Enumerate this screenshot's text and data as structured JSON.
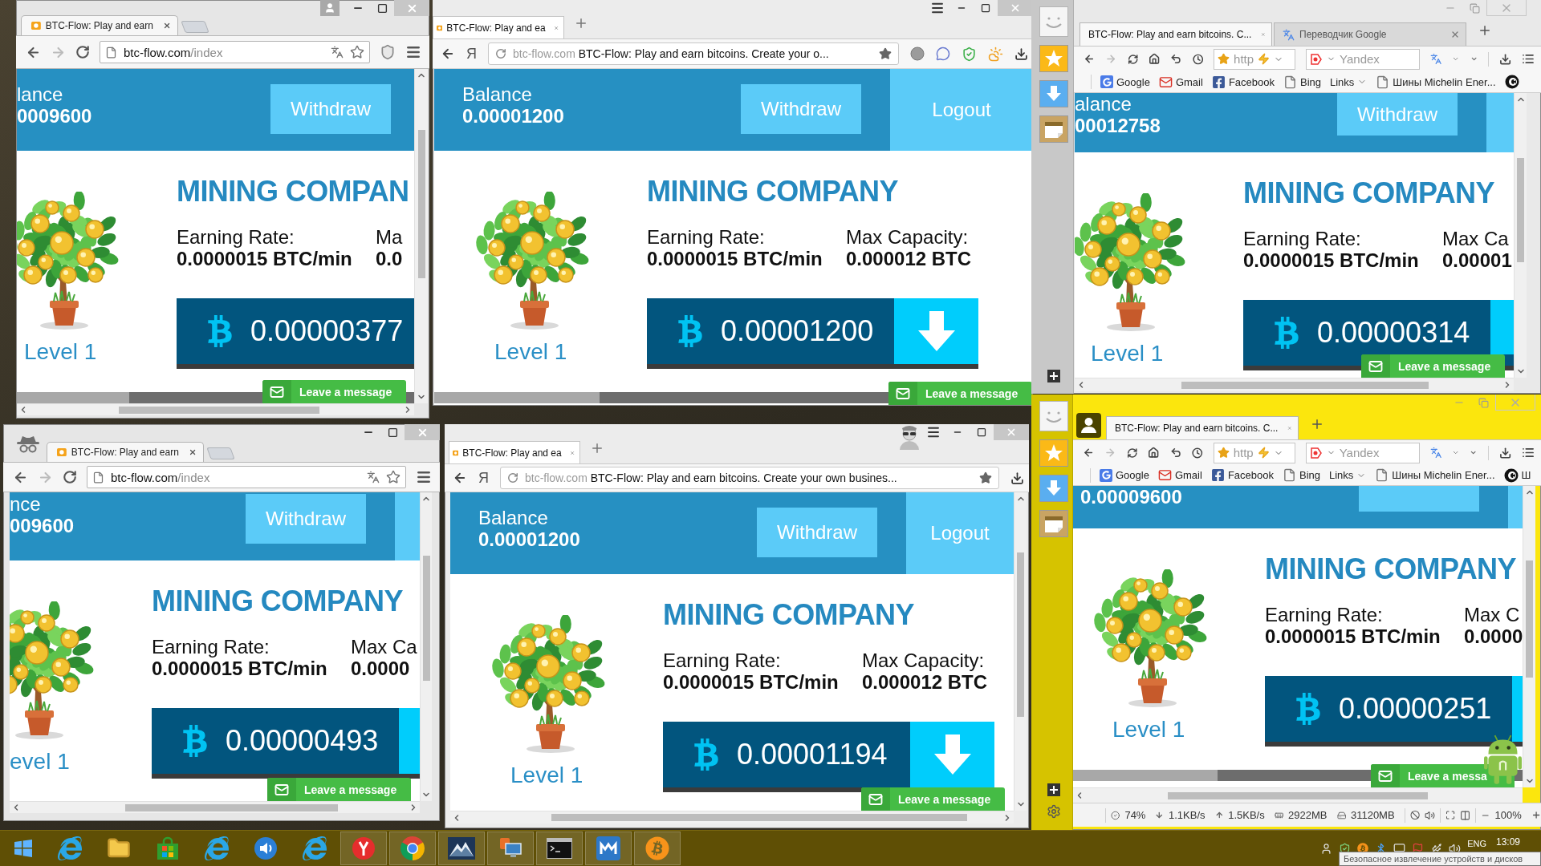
{
  "windows": [
    {
      "kind": "chrome",
      "incognito": false,
      "tabs": [
        {
          "title": "BTC-Flow: Play and earn",
          "selected": true
        }
      ],
      "address": {
        "host": "btc-flow.com",
        "path": "/index"
      },
      "page": {
        "balance_label": "lance",
        "balance": "0009600",
        "withdraw": "Withdraw",
        "heading": "MINING COMPAN",
        "stats": [
          {
            "label": "Earning Rate:",
            "value": "0.0000015 BTC/min"
          },
          {
            "label": "Ma",
            "value": "0.0"
          }
        ],
        "counter": "0.00000377",
        "level": "Level 1",
        "chat": "Leave a message"
      }
    },
    {
      "kind": "yandex",
      "incognito": false,
      "tabs": [
        {
          "title": "BTC-Flow: Play and ea",
          "selected": true
        }
      ],
      "home_button": "Я",
      "address": {
        "host": "btc-flow.com",
        "title": "BTC-Flow: Play and earn bitcoins. Create your o..."
      },
      "page": {
        "balance_label": "Balance",
        "balance": "0.00001200",
        "withdraw": "Withdraw",
        "logout": "Logout",
        "heading": "MINING COMPANY",
        "stats": [
          {
            "label": "Earning Rate:",
            "value": "0.0000015 BTC/min"
          },
          {
            "label": "Max Capacity:",
            "value": "0.000012 BTC"
          }
        ],
        "counter": "0.00001200",
        "level": "Level 1",
        "chat": "Leave a message"
      }
    },
    {
      "kind": "maxthon",
      "incognito": false,
      "tabs": [
        {
          "kind": "plain",
          "title": "BTC-Flow: Play and earn bitcoins. C...",
          "selected": true
        },
        {
          "kind": "translator",
          "title": "Переводчик Google",
          "selected": false
        }
      ],
      "address": "http",
      "search": {
        "placeholder": "Yandex"
      },
      "bookmarks": [
        {
          "kind": "google",
          "label": "Google"
        },
        {
          "kind": "gmail",
          "label": "Gmail"
        },
        {
          "kind": "facebook",
          "label": "Facebook"
        },
        {
          "kind": "page",
          "label": "Bing"
        },
        {
          "kind": "folder",
          "label": "Links"
        },
        {
          "kind": "page",
          "label": "Шины Michelin Ener..."
        },
        {
          "kind": "app"
        }
      ],
      "page": {
        "balance_label": "alance",
        "balance": "00012758",
        "withdraw": "Withdraw",
        "heading": "MINING COMPANY",
        "stats": [
          {
            "label": "Earning Rate:",
            "value": "0.0000015 BTC/min"
          },
          {
            "label": "Max Ca",
            "value": "0.00001"
          }
        ],
        "counter": "0.00000314",
        "level": "Level 1",
        "chat": "Leave a message"
      }
    },
    {
      "kind": "chrome",
      "incognito": true,
      "tabs": [
        {
          "title": "BTC-Flow: Play and earn",
          "selected": true
        }
      ],
      "address": {
        "host": "btc-flow.com",
        "path": "/index"
      },
      "page": {
        "balance_label": "nce",
        "balance": "009600",
        "withdraw": "Withdraw",
        "heading": "MINING COMPANY",
        "stats": [
          {
            "label": "Earning Rate:",
            "value": "0.0000015 BTC/min"
          },
          {
            "label": "Max Ca",
            "value": "0.0000"
          }
        ],
        "counter": "0.00000493",
        "level": "evel 1",
        "chat": "Leave a message"
      }
    },
    {
      "kind": "yandex",
      "incognito": true,
      "tabs": [
        {
          "title": "BTC-Flow: Play and ea",
          "selected": true
        }
      ],
      "home_button": "Я",
      "address": {
        "host": "btc-flow.com",
        "title": "BTC-Flow: Play and earn bitcoins. Create your own busines..."
      },
      "page": {
        "balance_label": "Balance",
        "balance": "0.00001200",
        "withdraw": "Withdraw",
        "logout": "Logout",
        "heading": "MINING COMPANY",
        "stats": [
          {
            "label": "Earning Rate:",
            "value": "0.0000015 BTC/min"
          },
          {
            "label": "Max Capacity:",
            "value": "0.000012 BTC"
          }
        ],
        "counter": "0.00001194",
        "level": "Level 1",
        "chat": "Leave a message"
      }
    },
    {
      "kind": "maxthon",
      "incognito": true,
      "tabs": [
        {
          "kind": "plain",
          "title": "BTC-Flow: Play and earn bitcoins. C...",
          "selected": true
        }
      ],
      "address": "http",
      "search": {
        "placeholder": "Yandex"
      },
      "bookmarks": [
        {
          "kind": "google",
          "label": "Google"
        },
        {
          "kind": "gmail",
          "label": "Gmail"
        },
        {
          "kind": "facebook",
          "label": "Facebook"
        },
        {
          "kind": "page",
          "label": "Bing"
        },
        {
          "kind": "folder",
          "label": "Links"
        },
        {
          "kind": "page",
          "label": "Шины Michelin Ener..."
        },
        {
          "kind": "app",
          "label": "Ш"
        }
      ],
      "page": {
        "balance": "0.00009600",
        "heading": "MINING COMPANY",
        "stats": [
          {
            "label": "Earning Rate:",
            "value": "0.0000015 BTC/min"
          },
          {
            "label": "Max C",
            "value": "0.0000"
          }
        ],
        "counter": "0.00000251",
        "level": "Level 1",
        "chat": "Leave a messa"
      },
      "status_bar": {
        "cpu": "74%",
        "download": "1.1KB/s",
        "upload": "1.5KB/s",
        "memory": "2922MB",
        "disk": "31120MB",
        "zoom": "100%"
      }
    }
  ],
  "taskbar": {
    "apps": [
      {
        "kind": "ie",
        "running": false
      },
      {
        "kind": "folder",
        "running": false
      },
      {
        "kind": "store",
        "running": false
      },
      {
        "kind": "ie",
        "running": false
      },
      {
        "kind": "speaker",
        "running": false
      },
      {
        "kind": "ie",
        "running": false
      },
      {
        "kind": "yandex",
        "running": true
      },
      {
        "kind": "chrome",
        "running": true
      },
      {
        "kind": "mountain",
        "running": true
      },
      {
        "kind": "remote",
        "running": true
      },
      {
        "kind": "terminal",
        "running": true
      },
      {
        "kind": "maxthon",
        "running": true
      },
      {
        "kind": "bitcoin",
        "running": true
      }
    ],
    "language": "ENG",
    "clock": "13:09",
    "tooltip": "Безопасное извлечение устройств и дисков"
  }
}
